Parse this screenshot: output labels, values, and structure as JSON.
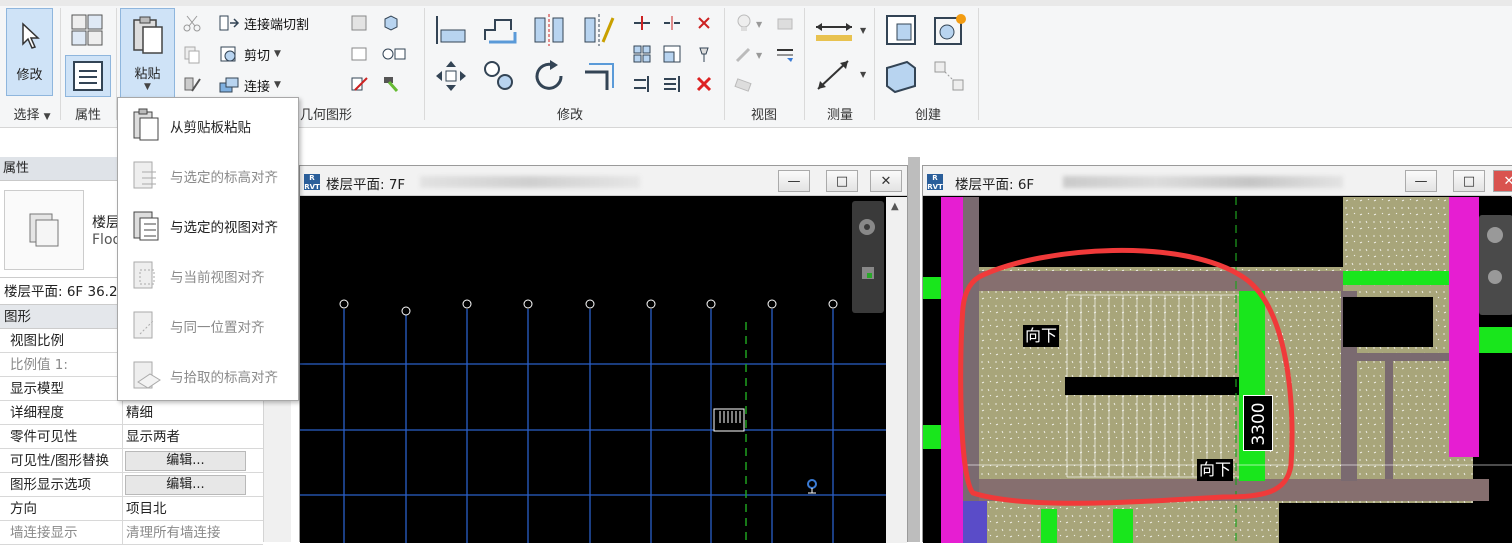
{
  "ribbon": {
    "modify_label": "修改",
    "paste_label": "粘贴",
    "cut_geometry_label": "连接端切割",
    "cut_label": "剪切",
    "join_label": "连接",
    "geometry_group_partial": "几何图形",
    "groups": {
      "select": "选择",
      "properties": "属性",
      "modify": "修改",
      "view": "视图",
      "measure": "测量",
      "create": "创建"
    }
  },
  "paste_menu": {
    "items": [
      {
        "label": "从剪贴板粘贴",
        "enabled": true
      },
      {
        "label": "与选定的标高对齐",
        "enabled": false
      },
      {
        "label": "与选定的视图对齐",
        "enabled": true
      },
      {
        "label": "与当前视图对齐",
        "enabled": false
      },
      {
        "label": "与同一位置对齐",
        "enabled": false
      },
      {
        "label": "与拾取的标高对齐",
        "enabled": false
      }
    ]
  },
  "properties": {
    "header": "属性",
    "type_name_line1": "楼层",
    "type_name_line2": "Floo",
    "instance_selector": "楼层平面: 6F 36.2",
    "section": "图形",
    "rows": [
      {
        "key": "视图比例",
        "value": "",
        "gray": false
      },
      {
        "key": "比例值 1:",
        "value": "",
        "gray": true
      },
      {
        "key": "显示模型",
        "value": "",
        "gray": false
      },
      {
        "key": "详细程度",
        "value": "精细",
        "gray": false
      },
      {
        "key": "零件可见性",
        "value": "显示两者",
        "gray": false
      },
      {
        "key": "可见性/图形替换",
        "value": "编辑...",
        "gray": false,
        "button": true
      },
      {
        "key": "图形显示选项",
        "value": "编辑...",
        "gray": false,
        "button": true
      },
      {
        "key": "方向",
        "value": "项目北",
        "gray": false
      },
      {
        "key": "墙连接显示",
        "value": "清理所有墙连接",
        "gray": true
      }
    ]
  },
  "view_left": {
    "title": "楼层平面: 7F"
  },
  "view_right": {
    "title": "楼层平面: 6F",
    "annotations": {
      "down1": "向下",
      "down2": "向下",
      "dimension": "3300"
    }
  },
  "colors": {
    "accent": "#cfe3f7",
    "markup_red": "#f03a3a",
    "floor_fill": "#a8a57a",
    "wall_magenta": "#e61ed2",
    "green": "#19e61c"
  }
}
